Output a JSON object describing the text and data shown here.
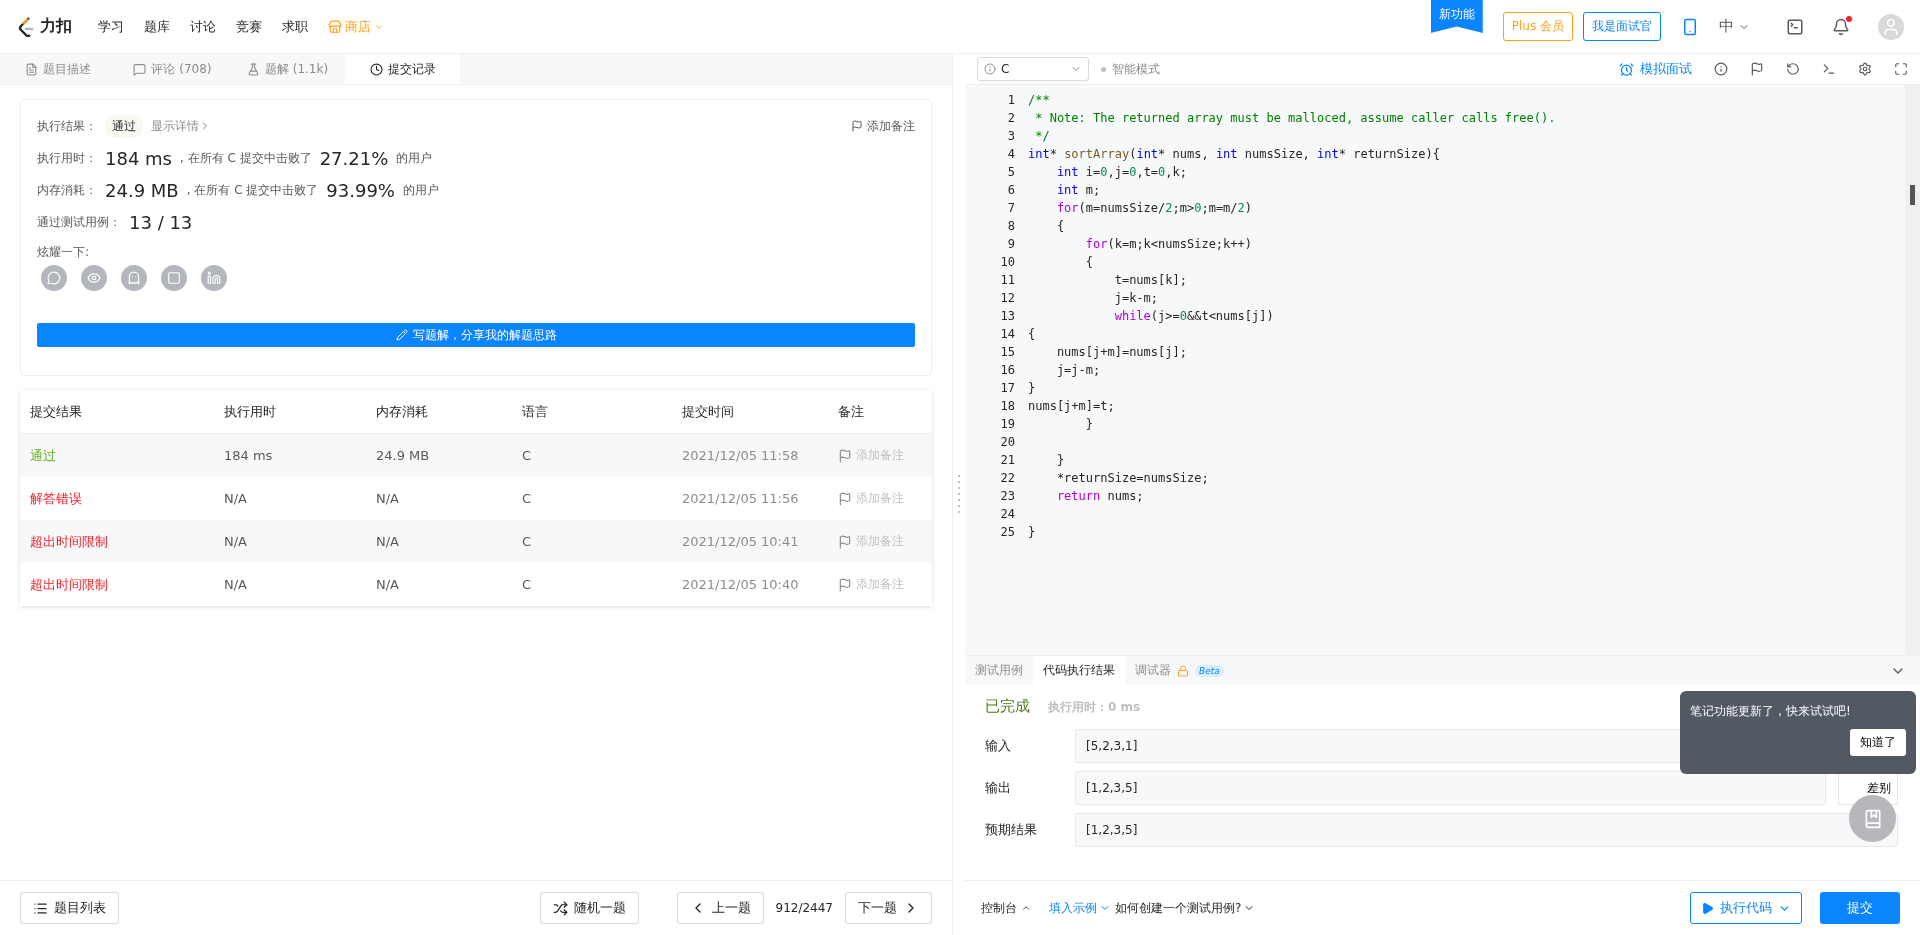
{
  "nav": {
    "logo": "力扣",
    "items": [
      {
        "label": "学习",
        "kind": "link"
      },
      {
        "label": "题库",
        "kind": "link"
      },
      {
        "label": "讨论",
        "kind": "link"
      },
      {
        "label": "竞赛",
        "kind": "link"
      },
      {
        "label": "求职",
        "kind": "link"
      },
      {
        "label": "商店",
        "kind": "shop"
      }
    ],
    "new_badge": "新功能",
    "plus_button": "Plus 会员",
    "interviewer_button": "我是面试官",
    "language": "中"
  },
  "left_tabs": [
    {
      "label": "题目描述",
      "selected": false
    },
    {
      "label": "评论 (708)",
      "selected": false
    },
    {
      "label": "题解 (1.1k)",
      "selected": false
    },
    {
      "label": "提交记录",
      "selected": true
    }
  ],
  "result_card": {
    "result_label": "执行结果：",
    "result_badge": "通过",
    "details_link": "显示详情",
    "add_note": "添加备注",
    "stats": [
      {
        "label": "执行用时：",
        "value": "184 ms",
        "mid": ", 在所有 C 提交中击败了",
        "percent": "27.21%",
        "tail": "的用户"
      },
      {
        "label": "内存消耗：",
        "value": "24.9 MB",
        "mid": ", 在所有 C 提交中击败了",
        "percent": "93.99%",
        "tail": "的用户"
      }
    ],
    "cases_label": "通过测试用例：",
    "cases_value": "13 / 13",
    "share_label": "炫耀一下:",
    "write_button": "写题解，分享我的解题思路"
  },
  "submissions": {
    "columns": [
      "提交结果",
      "执行用时",
      "内存消耗",
      "语言",
      "提交时间",
      "备注"
    ],
    "rows": [
      {
        "status": "通过",
        "color": "#5eb31b",
        "runtime": "184 ms",
        "memory": "24.9 MB",
        "language": "C",
        "time": "2021/12/05 11:58",
        "note": "添加备注"
      },
      {
        "status": "解答错误",
        "color": "#f5222d",
        "runtime": "N/A",
        "memory": "N/A",
        "language": "C",
        "time": "2021/12/05 11:56",
        "note": "添加备注"
      },
      {
        "status": "超出时间限制",
        "color": "#f5222d",
        "runtime": "N/A",
        "memory": "N/A",
        "language": "C",
        "time": "2021/12/05 10:41",
        "note": "添加备注"
      },
      {
        "status": "超出时间限制",
        "color": "#f5222d",
        "runtime": "N/A",
        "memory": "N/A",
        "language": "C",
        "time": "2021/12/05 10:40",
        "note": "添加备注"
      }
    ]
  },
  "left_footer": {
    "problem_list": "题目列表",
    "random": "随机一题",
    "prev": "上一题",
    "counter": "912/2447",
    "next": "下一题"
  },
  "editor_toolbar": {
    "language": "C",
    "mode": "智能模式",
    "interview": "模拟面试"
  },
  "code": [
    {
      "no": "1",
      "segments": [
        {
          "text": "/**",
          "kind": "comment"
        }
      ]
    },
    {
      "no": "2",
      "segments": [
        {
          "text": " * Note: The returned array must be malloced, assume caller calls free().",
          "kind": "comment"
        }
      ]
    },
    {
      "no": "3",
      "segments": [
        {
          "text": " */",
          "kind": "comment"
        }
      ]
    },
    {
      "no": "4",
      "segments": [
        {
          "text": "int",
          "kind": "type"
        },
        {
          "text": "* ",
          "kind": "plain"
        },
        {
          "text": "sortArray",
          "kind": "function"
        },
        {
          "text": "(",
          "kind": "plain"
        },
        {
          "text": "int",
          "kind": "type"
        },
        {
          "text": "* nums, ",
          "kind": "plain"
        },
        {
          "text": "int",
          "kind": "type"
        },
        {
          "text": " numsSize, ",
          "kind": "plain"
        },
        {
          "text": "int",
          "kind": "type"
        },
        {
          "text": "* returnSize){",
          "kind": "plain"
        }
      ]
    },
    {
      "no": "5",
      "segments": [
        {
          "text": "    int",
          "kind": "type"
        },
        {
          "text": " i=",
          "kind": "plain"
        },
        {
          "text": "0",
          "kind": "number"
        },
        {
          "text": ",j=",
          "kind": "plain"
        },
        {
          "text": "0",
          "kind": "number"
        },
        {
          "text": ",t=",
          "kind": "plain"
        },
        {
          "text": "0",
          "kind": "number"
        },
        {
          "text": ",k;",
          "kind": "plain"
        }
      ]
    },
    {
      "no": "6",
      "segments": [
        {
          "text": "    int",
          "kind": "type"
        },
        {
          "text": " m;",
          "kind": "plain"
        }
      ]
    },
    {
      "no": "7",
      "segments": [
        {
          "text": "    for",
          "kind": "keyword"
        },
        {
          "text": "(m=numsSize/",
          "kind": "plain"
        },
        {
          "text": "2",
          "kind": "number"
        },
        {
          "text": ";m>",
          "kind": "plain"
        },
        {
          "text": "0",
          "kind": "number"
        },
        {
          "text": ";m=m/",
          "kind": "plain"
        },
        {
          "text": "2",
          "kind": "number"
        },
        {
          "text": ")",
          "kind": "plain"
        }
      ]
    },
    {
      "no": "8",
      "segments": [
        {
          "text": "    {",
          "kind": "plain"
        }
      ]
    },
    {
      "no": "9",
      "segments": [
        {
          "text": "        for",
          "kind": "keyword"
        },
        {
          "text": "(k=m;k<numsSize;k++)",
          "kind": "plain"
        }
      ]
    },
    {
      "no": "10",
      "segments": [
        {
          "text": "        {",
          "kind": "plain"
        }
      ]
    },
    {
      "no": "11",
      "segments": [
        {
          "text": "            t=nums[k];",
          "kind": "plain"
        }
      ]
    },
    {
      "no": "12",
      "segments": [
        {
          "text": "            j=k-m;",
          "kind": "plain"
        }
      ]
    },
    {
      "no": "13",
      "segments": [
        {
          "text": "            while",
          "kind": "keyword"
        },
        {
          "text": "(j>=",
          "kind": "plain"
        },
        {
          "text": "0",
          "kind": "number"
        },
        {
          "text": "&&t<nums[j])",
          "kind": "plain"
        }
      ]
    },
    {
      "no": "14",
      "segments": [
        {
          "text": "{",
          "kind": "plain"
        }
      ]
    },
    {
      "no": "15",
      "segments": [
        {
          "text": "    nums[j+m]=nums[j];",
          "kind": "plain"
        }
      ]
    },
    {
      "no": "16",
      "segments": [
        {
          "text": "    j=j-m;",
          "kind": "plain"
        }
      ]
    },
    {
      "no": "17",
      "segments": [
        {
          "text": "}",
          "kind": "plain"
        }
      ]
    },
    {
      "no": "18",
      "segments": [
        {
          "text": "nums[j+m]=t;",
          "kind": "plain"
        }
      ]
    },
    {
      "no": "19",
      "segments": [
        {
          "text": "        }",
          "kind": "plain"
        }
      ]
    },
    {
      "no": "20"
    },
    {
      "no": "21",
      "segments": [
        {
          "text": "    }",
          "kind": "plain"
        }
      ]
    },
    {
      "no": "22",
      "segments": [
        {
          "text": "    *returnSize=numsSize;",
          "kind": "plain"
        }
      ]
    },
    {
      "no": "23",
      "segments": [
        {
          "text": "    return",
          "kind": "keyword"
        },
        {
          "text": " nums;",
          "kind": "plain"
        }
      ]
    },
    {
      "no": "24"
    },
    {
      "no": "25",
      "segments": [
        {
          "text": "}",
          "kind": "plain"
        }
      ]
    }
  ],
  "console": {
    "tabs": [
      {
        "label": "测试用例",
        "selected": false,
        "locked": false
      },
      {
        "label": "代码执行结果",
        "selected": true,
        "locked": false
      },
      {
        "label": "调试器",
        "selected": false,
        "locked": true,
        "badge": "Beta"
      }
    ],
    "status": "已完成",
    "runtime": "执行用时：0 ms",
    "fields": [
      {
        "label": "输入",
        "value": "[5,2,3,1]"
      },
      {
        "label": "输出",
        "value": "[1,2,3,5]"
      },
      {
        "label": "预期结果",
        "value": "[1,2,3,5]"
      }
    ],
    "diff_button": "差别"
  },
  "tooltip": {
    "text": "笔记功能更新了，快来试试吧!",
    "button": "知道了"
  },
  "right_footer": {
    "console_toggle": "控制台",
    "fill_example": "填入示例",
    "how_to": "如何创建一个测试用例?",
    "run": "执行代码",
    "submit": "提交"
  }
}
